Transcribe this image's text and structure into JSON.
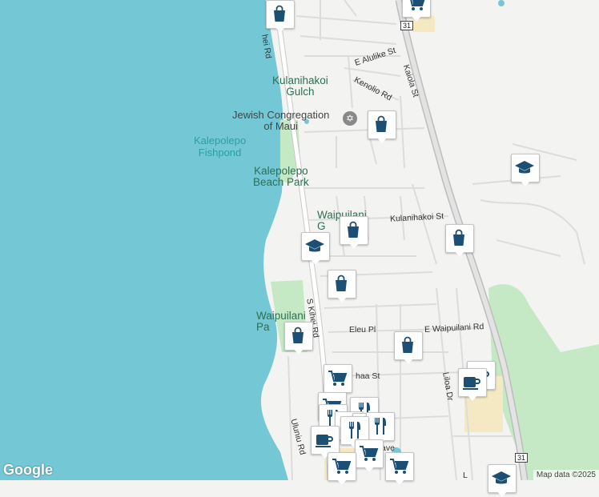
{
  "map": {
    "colors": {
      "water": "#74c8d6",
      "land": "#f3f3f1",
      "park": "#c5e8c5",
      "road": "#ffffff",
      "highway": "#c9c9c9",
      "pin_icon": "#1c4f74",
      "sand": "#f4e9c2"
    },
    "water_labels": [
      {
        "name": "kalepolepo-fishpond-label",
        "text": "Kalepolepo\nFishpond"
      }
    ],
    "poi_labels": [
      {
        "name": "kulanihakoi-gulch-label",
        "text": "Kulanihakoi\nGulch"
      },
      {
        "name": "kalepolepo-beach-park-label",
        "text": "Kalepolepo\nBeach Park"
      },
      {
        "name": "waipuilani-gulch-label",
        "text": "Waipuilani\nG"
      },
      {
        "name": "waipuilani-park-label",
        "text": "Waipuilani\nPa"
      }
    ],
    "place_labels": [
      {
        "name": "jewish-congregation-label",
        "text": "Jewish Congregation\nof Maui"
      }
    ],
    "road_labels": [
      "S Kihei Rd",
      "hei Rd",
      "E Alulike St",
      "Kenolio Rd",
      "Kaiola St",
      "Kulanihakoi St",
      "Eleu Pl",
      "E Waipuilani Rd",
      "haa St",
      "Liloa Dr",
      "Uluniu Rd",
      "ave",
      "L"
    ],
    "highway_shields": [
      "31",
      "31"
    ],
    "markers": [
      {
        "type": "shopping",
        "icon": "shopping-bag-icon"
      },
      {
        "type": "grocery",
        "icon": "shopping-cart-icon"
      },
      {
        "type": "shopping",
        "icon": "shopping-bag-icon"
      },
      {
        "type": "school",
        "icon": "graduation-cap-icon"
      },
      {
        "type": "shopping",
        "icon": "shopping-bag-icon"
      },
      {
        "type": "shopping",
        "icon": "shopping-bag-icon"
      },
      {
        "type": "school",
        "icon": "graduation-cap-icon"
      },
      {
        "type": "shopping",
        "icon": "shopping-bag-icon"
      },
      {
        "type": "shopping",
        "icon": "shopping-bag-icon"
      },
      {
        "type": "shopping",
        "icon": "shopping-bag-icon"
      },
      {
        "type": "grocery",
        "icon": "shopping-cart-icon"
      },
      {
        "type": "cafe",
        "icon": "coffee-cup-icon"
      },
      {
        "type": "cafe",
        "icon": "coffee-cup-icon"
      },
      {
        "type": "grocery",
        "icon": "shopping-cart-icon"
      },
      {
        "type": "restaurant",
        "icon": "fork-knife-icon"
      },
      {
        "type": "restaurant",
        "icon": "fork-knife-icon"
      },
      {
        "type": "restaurant",
        "icon": "fork-knife-icon"
      },
      {
        "type": "restaurant",
        "icon": "fork-knife-icon"
      },
      {
        "type": "restaurant",
        "icon": "fork-knife-icon"
      },
      {
        "type": "restaurant",
        "icon": "fork-knife-icon"
      },
      {
        "type": "cafe",
        "icon": "coffee-cup-icon"
      },
      {
        "type": "grocery",
        "icon": "shopping-cart-icon"
      },
      {
        "type": "grocery",
        "icon": "shopping-cart-icon"
      },
      {
        "type": "grocery",
        "icon": "shopping-cart-icon"
      },
      {
        "type": "school",
        "icon": "graduation-cap-icon"
      }
    ]
  },
  "attribution": {
    "logo": "Google",
    "map_data": "Map data ©2025"
  }
}
